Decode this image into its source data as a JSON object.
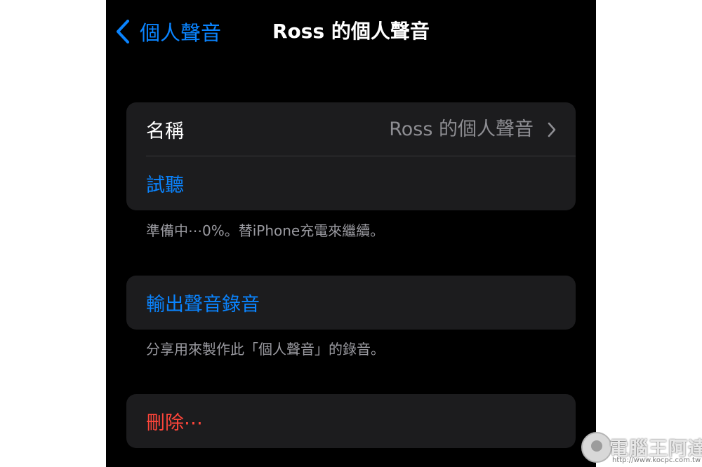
{
  "nav": {
    "back_label": "個人聲音",
    "title": "Ross 的個人聲音"
  },
  "group1": {
    "name_label": "名稱",
    "name_value": "Ross 的個人聲音",
    "listen_label": "試聽"
  },
  "footer1": "準備中⋯0%。替iPhone充電來繼續。",
  "group2": {
    "export_label": "輸出聲音錄音"
  },
  "footer2": "分享用來製作此「個人聲音」的錄音。",
  "group3": {
    "delete_label": "刪除⋯"
  },
  "watermark": {
    "text": "電腦王阿達",
    "url": "http://www.kocpc.com.tw"
  },
  "colors": {
    "accent": "#0a84ff",
    "destructive": "#ff453a",
    "background": "#000000",
    "cell": "#1c1c1e"
  },
  "icons": {
    "back": "chevron-left-icon",
    "disclosure": "chevron-right-icon"
  }
}
